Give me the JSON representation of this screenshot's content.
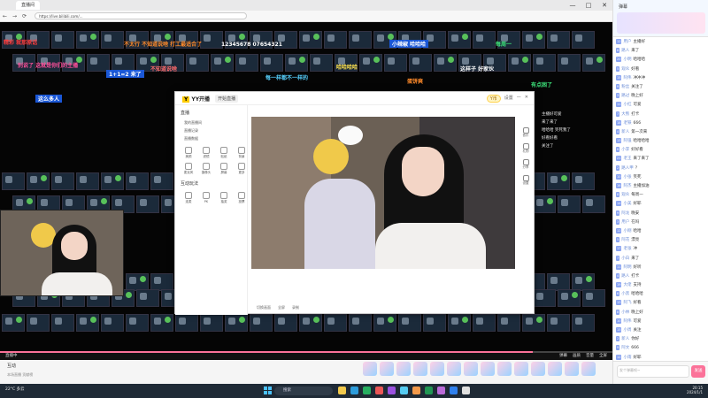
{
  "browser": {
    "tab_title": "直播间",
    "url": "https://live.bilibili.com/...",
    "window_buttons": [
      "—",
      "□",
      "✕"
    ],
    "nav_icons": [
      "←",
      "→",
      "⟳"
    ]
  },
  "danmaku": [
    {
      "text": "精彩 就那原话",
      "color": "#ff3b3b"
    },
    {
      "text": "不太行 不知道说啥 打工最适合了",
      "color": "#ff8a2a"
    },
    {
      "text": "12345678 07654321",
      "color": "#ffffff"
    },
    {
      "text": "小辣椒 哈哈哈",
      "color": "#ffe14d"
    },
    {
      "text": "每周一",
      "color": "#3de27a"
    },
    {
      "text": "别说了 这就是你们的主播",
      "color": "#ff4f9a"
    },
    {
      "text": "不知道说啥",
      "color": "#ff6b6b"
    },
    {
      "text": "哈哈哈哈",
      "color": "#ffe14d"
    },
    {
      "text": "1+1=2 来了",
      "color": "#ffcf3b"
    },
    {
      "text": "每一样都不一样的",
      "color": "#56d1ff"
    },
    {
      "text": "蛋饼爽",
      "color": "#ff8a2a"
    },
    {
      "text": "这样子 好家伙",
      "color": "#ffffff"
    },
    {
      "text": "有点困了",
      "color": "#3de27a"
    },
    {
      "text": "这么多人",
      "color": "#ff4f4f"
    }
  ],
  "yy": {
    "logo": "YY开播",
    "live_btn": "开始直播",
    "coin": "Y币",
    "right_items": [
      "设置",
      "—",
      "✕"
    ],
    "section": "直播",
    "items": [
      "我的直播间",
      "直播记录",
      "直播数据"
    ],
    "icons": [
      "美颜",
      "滤镜",
      "贴纸",
      "背景",
      "麦克风",
      "摄像头",
      "屏幕",
      "更多"
    ],
    "section2": "互动玩法",
    "icons2": [
      "连麦",
      "PK",
      "抽奖",
      "投票"
    ],
    "controls": [
      "切换画面",
      "全屏",
      "录制"
    ],
    "tools": [
      "音乐",
      "礼物",
      "分享",
      "设置"
    ]
  },
  "video_chat": [
    "主播好可爱",
    "来了来了",
    "哈哈哈 笑死我了",
    "好看好看",
    "关注了"
  ],
  "player": {
    "live_label": "直播中",
    "progress": 0.87,
    "right_items": [
      "弹幕",
      "画质",
      "音量",
      "全屏"
    ]
  },
  "bottom": {
    "title": "互动",
    "sub": "本场直播 贡献榜"
  },
  "chat": {
    "title": "弹幕",
    "messages": [
      {
        "lvl": "12",
        "name": "用户",
        "text": "主播好"
      },
      {
        "lvl": "8",
        "name": "路人",
        "text": "来了"
      },
      {
        "lvl": "20",
        "name": "小明",
        "text": "哈哈哈"
      },
      {
        "lvl": "5",
        "name": "观众",
        "text": "好看"
      },
      {
        "lvl": "15",
        "name": "阿伟",
        "text": "冲冲冲"
      },
      {
        "lvl": "9",
        "name": "粉丝",
        "text": "关注了"
      },
      {
        "lvl": "3",
        "name": "路过",
        "text": "晚上好"
      },
      {
        "lvl": "11",
        "name": "小红",
        "text": "可爱"
      },
      {
        "lvl": "7",
        "name": "大熊",
        "text": "打卡"
      },
      {
        "lvl": "18",
        "name": "老铁",
        "text": "666"
      },
      {
        "lvl": "4",
        "name": "新人",
        "text": "第一次来"
      },
      {
        "lvl": "13",
        "name": "阿强",
        "text": "哈哈哈哈"
      },
      {
        "lvl": "6",
        "name": "小李",
        "text": "好好看"
      },
      {
        "lvl": "21",
        "name": "老王",
        "text": "来了来了"
      },
      {
        "lvl": "2",
        "name": "路人甲",
        "text": "？"
      },
      {
        "lvl": "10",
        "name": "小张",
        "text": "笑死"
      },
      {
        "lvl": "16",
        "name": "阿杰",
        "text": "主播加油"
      },
      {
        "lvl": "8",
        "name": "观众",
        "text": "每周一"
      },
      {
        "lvl": "14",
        "name": "小美",
        "text": "好耶"
      },
      {
        "lvl": "9",
        "name": "阿龙",
        "text": "晚安"
      },
      {
        "lvl": "3",
        "name": "用户",
        "text": "在吗"
      },
      {
        "lvl": "12",
        "name": "小刚",
        "text": "哈哈"
      },
      {
        "lvl": "5",
        "name": "阿花",
        "text": "漂亮"
      },
      {
        "lvl": "17",
        "name": "老张",
        "text": "冲"
      },
      {
        "lvl": "7",
        "name": "小白",
        "text": "来了"
      },
      {
        "lvl": "11",
        "name": "阿明",
        "text": "好听"
      },
      {
        "lvl": "4",
        "name": "路人",
        "text": "打卡"
      },
      {
        "lvl": "19",
        "name": "大佬",
        "text": "支持"
      },
      {
        "lvl": "6",
        "name": "小黑",
        "text": "哈哈哈"
      },
      {
        "lvl": "13",
        "name": "阿飞",
        "text": "好看"
      },
      {
        "lvl": "8",
        "name": "小林",
        "text": "晚上好"
      },
      {
        "lvl": "10",
        "name": "阿伟",
        "text": "可爱"
      },
      {
        "lvl": "15",
        "name": "小周",
        "text": "关注"
      },
      {
        "lvl": "2",
        "name": "新人",
        "text": "你好"
      },
      {
        "lvl": "9",
        "name": "阿文",
        "text": "666"
      },
      {
        "lvl": "12",
        "name": "小雨",
        "text": "好耶"
      }
    ],
    "input_placeholder": "发个弹幕呗~",
    "send_label": "发送"
  },
  "taskbar": {
    "weather": "22°C 多云",
    "search": "搜索",
    "time": "20:15",
    "date": "2024/1/1",
    "app_colors": [
      "#f2c94c",
      "#2d9cdb",
      "#27ae60",
      "#eb5757",
      "#9b51e0",
      "#56ccf2",
      "#f2994a",
      "#219653",
      "#bb6bd9",
      "#2f80ed",
      "#e0e0e0"
    ]
  }
}
